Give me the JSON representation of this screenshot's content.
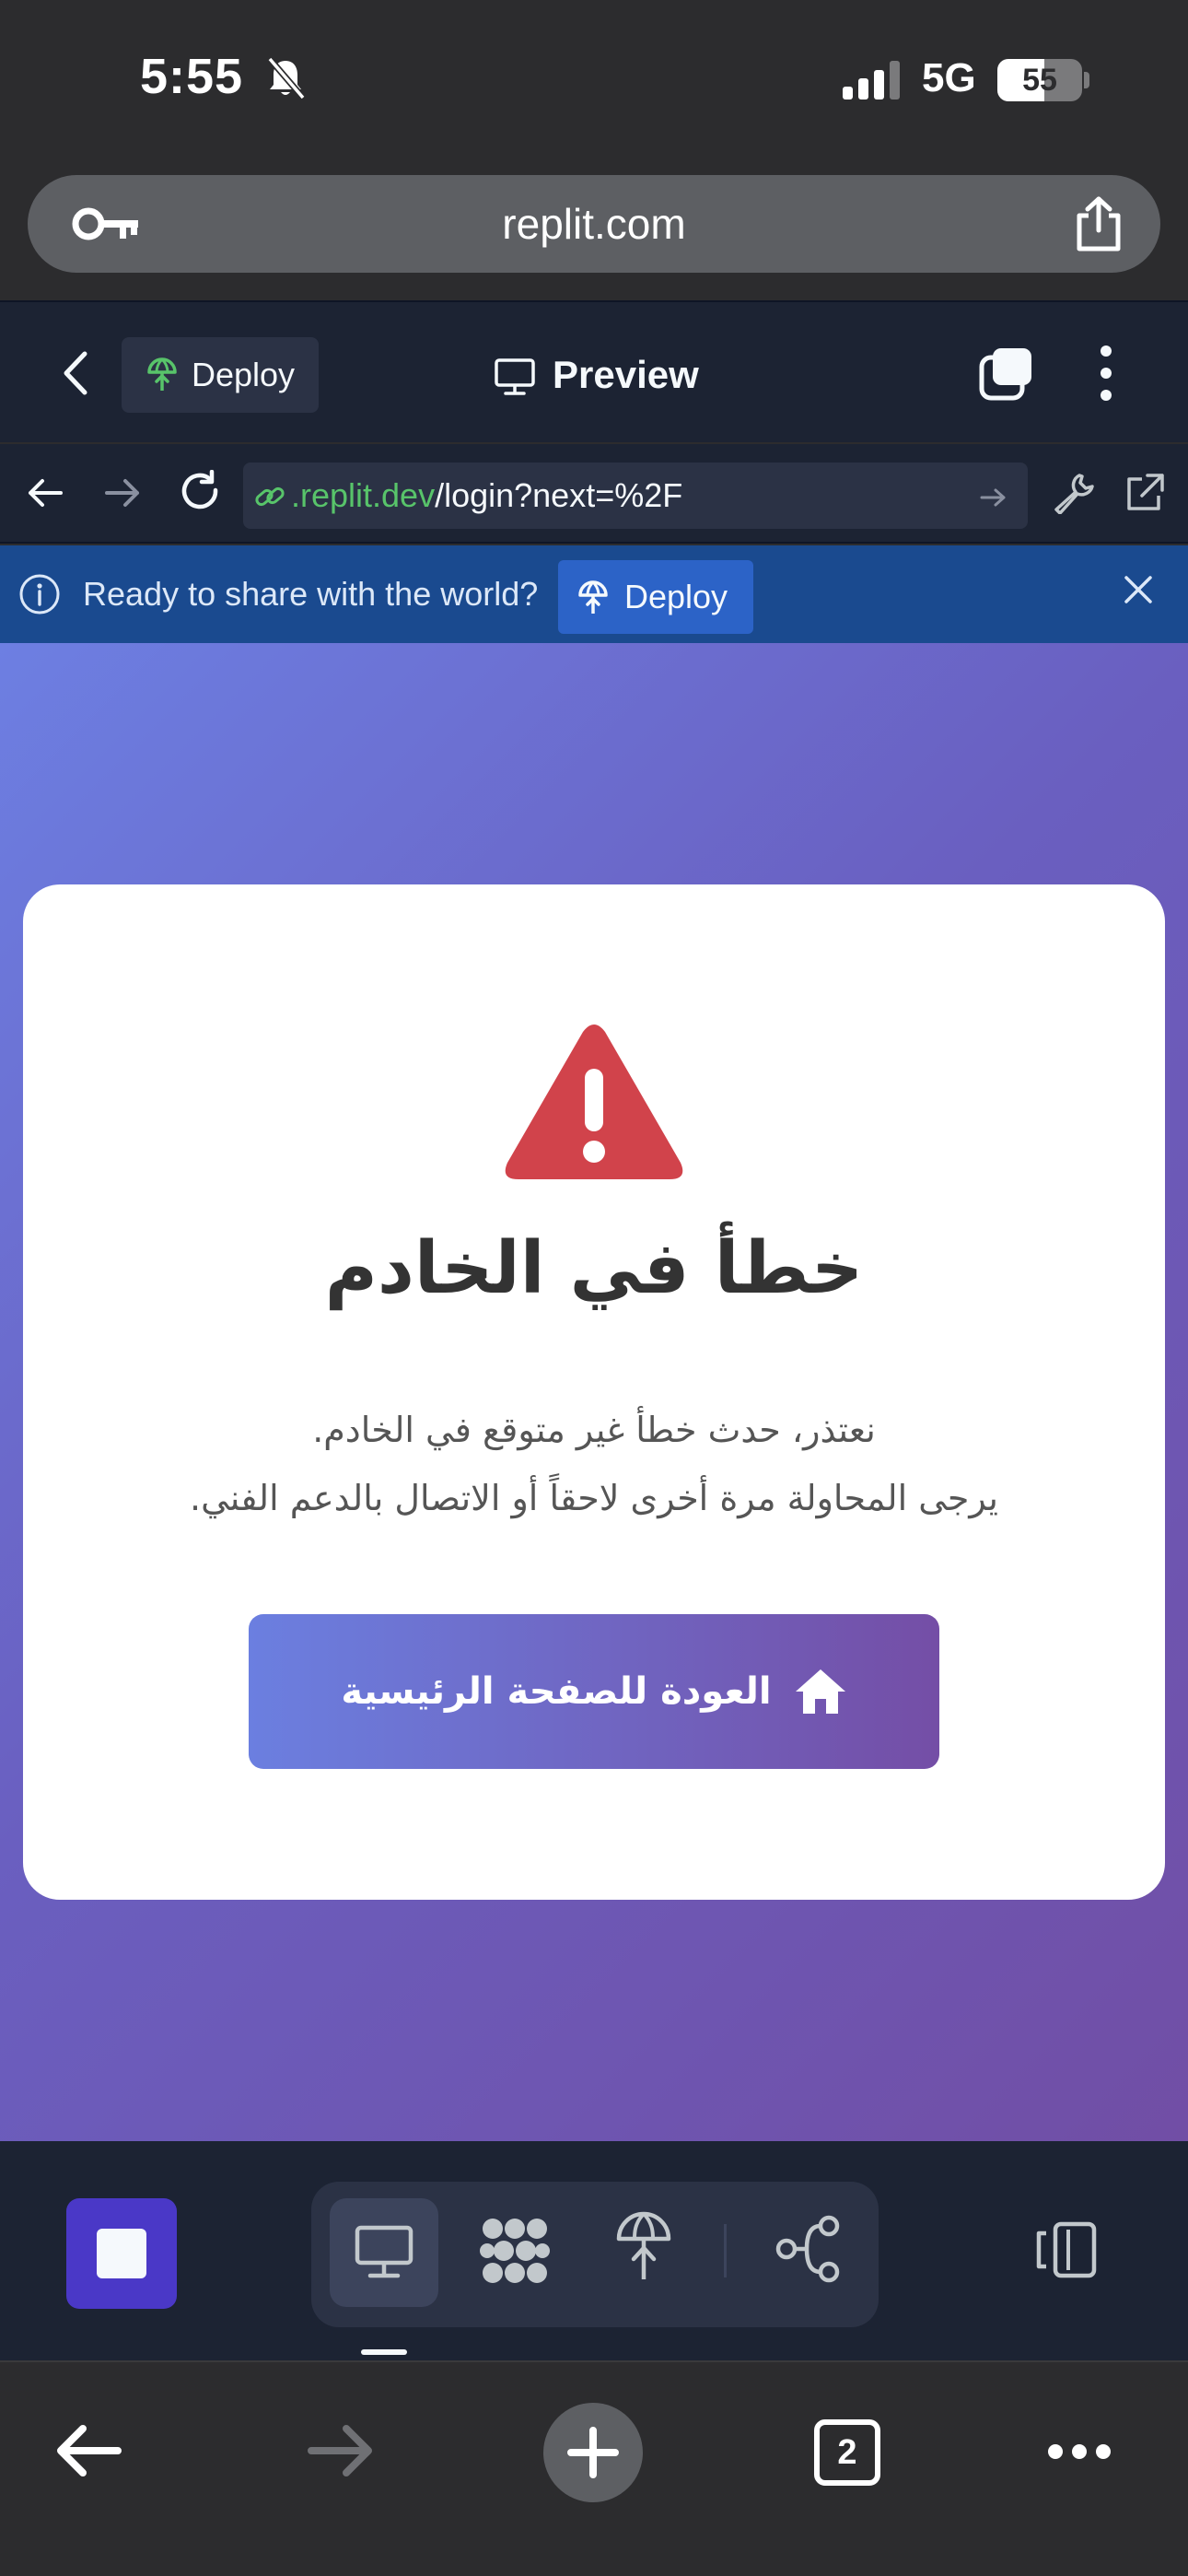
{
  "status_bar": {
    "time": "5:55",
    "network": "5G",
    "battery_level": "55",
    "battery_fraction": 0.55
  },
  "safari": {
    "domain": "replit.com"
  },
  "replit_header": {
    "deploy_label": "Deploy",
    "title": "Preview"
  },
  "webview": {
    "url_domain": ".replit.dev",
    "url_path": "/login?next=%2F"
  },
  "banner": {
    "message": "Ready to share with the world?",
    "deploy_label": "Deploy"
  },
  "error_page": {
    "title": "خطأ في الخادم",
    "message_line1": "نعتذر، حدث خطأ غير متوقع في الخادم.",
    "message_line2": "يرجى المحاولة مرة أخرى لاحقاً أو الاتصال بالدعم الفني.",
    "home_button_label": "العودة للصفحة الرئيسية"
  },
  "safari_bottom": {
    "tab_count": "2"
  },
  "colors": {
    "replit_bg": "#1c2333",
    "banner_bg": "#1a4a8f",
    "warning_red": "#d1434b",
    "accent_purple": "#4a38c7",
    "url_green": "#58c46a"
  },
  "icons": [
    "bell-slash-icon",
    "signal-icon",
    "key-icon",
    "share-icon",
    "chevron-left-icon",
    "deploy-icon",
    "monitor-icon",
    "tabs-icon",
    "kebab-icon",
    "arrow-left-icon",
    "arrow-right-icon",
    "reload-icon",
    "link-icon",
    "wrench-icon",
    "external-link-icon",
    "info-icon",
    "close-icon",
    "warning-triangle-icon",
    "home-icon",
    "stop-icon",
    "cluster-icon",
    "git-icon",
    "devices-icon",
    "plus-icon",
    "more-icon"
  ]
}
